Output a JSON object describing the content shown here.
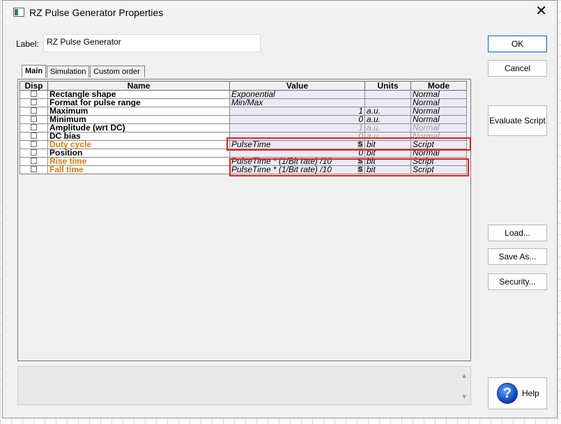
{
  "window": {
    "title": "RZ Pulse Generator Properties",
    "close_glyph": "✕"
  },
  "label_field": {
    "caption": "Label:",
    "value": "RZ Pulse Generator"
  },
  "tabs": [
    {
      "label": "Main",
      "active": true
    },
    {
      "label": "Simulation",
      "active": false
    },
    {
      "label": "Custom order",
      "active": false
    }
  ],
  "table": {
    "headers": {
      "disp": "Disp",
      "name": "Name",
      "value": "Value",
      "units": "Units",
      "mode": "Mode"
    },
    "rows": [
      {
        "name": "Rectangle shape",
        "value": "Exponential",
        "units": "",
        "mode": "Normal"
      },
      {
        "name": "Format for pulse range",
        "value": "Min/Max",
        "units": "",
        "mode": "Normal"
      },
      {
        "name": "Maximum",
        "value": "1",
        "units": "a.u.",
        "mode": "Normal"
      },
      {
        "name": "Minimum",
        "value": "0",
        "units": "a.u.",
        "mode": "Normal"
      },
      {
        "name": "Amplitude (wrt DC)",
        "value": "1",
        "units": "a.u.",
        "mode": "Normal"
      },
      {
        "name": "DC bias",
        "value": "0",
        "units": "a.u.",
        "mode": "Normal"
      },
      {
        "name": "Duty cycle",
        "value": "PulseTime",
        "units": "bit",
        "mode": "Script"
      },
      {
        "name": "Position",
        "value": "0",
        "units": "bit",
        "mode": "Normal"
      },
      {
        "name": "Rise time",
        "value": "PulseTime * (1/Bit rate) /10",
        "units": "bit",
        "mode": "Script"
      },
      {
        "name": "Fall time",
        "value": "PulseTime * (1/Bit rate) /10",
        "units": "bit",
        "mode": "Script"
      }
    ],
    "script_marker": "S"
  },
  "buttons": {
    "ok": "OK",
    "cancel": "Cancel",
    "evaluate_script": "Evaluate Script",
    "load": "Load...",
    "save_as": "Save As...",
    "security": "Security...",
    "help": "Help"
  },
  "icons": {
    "help": "?",
    "scroll_up": "▲",
    "scroll_down": "▼"
  },
  "colors": {
    "script_name": "#e07a00",
    "highlight": "#e02020",
    "default_button_border": "#0067c0"
  }
}
